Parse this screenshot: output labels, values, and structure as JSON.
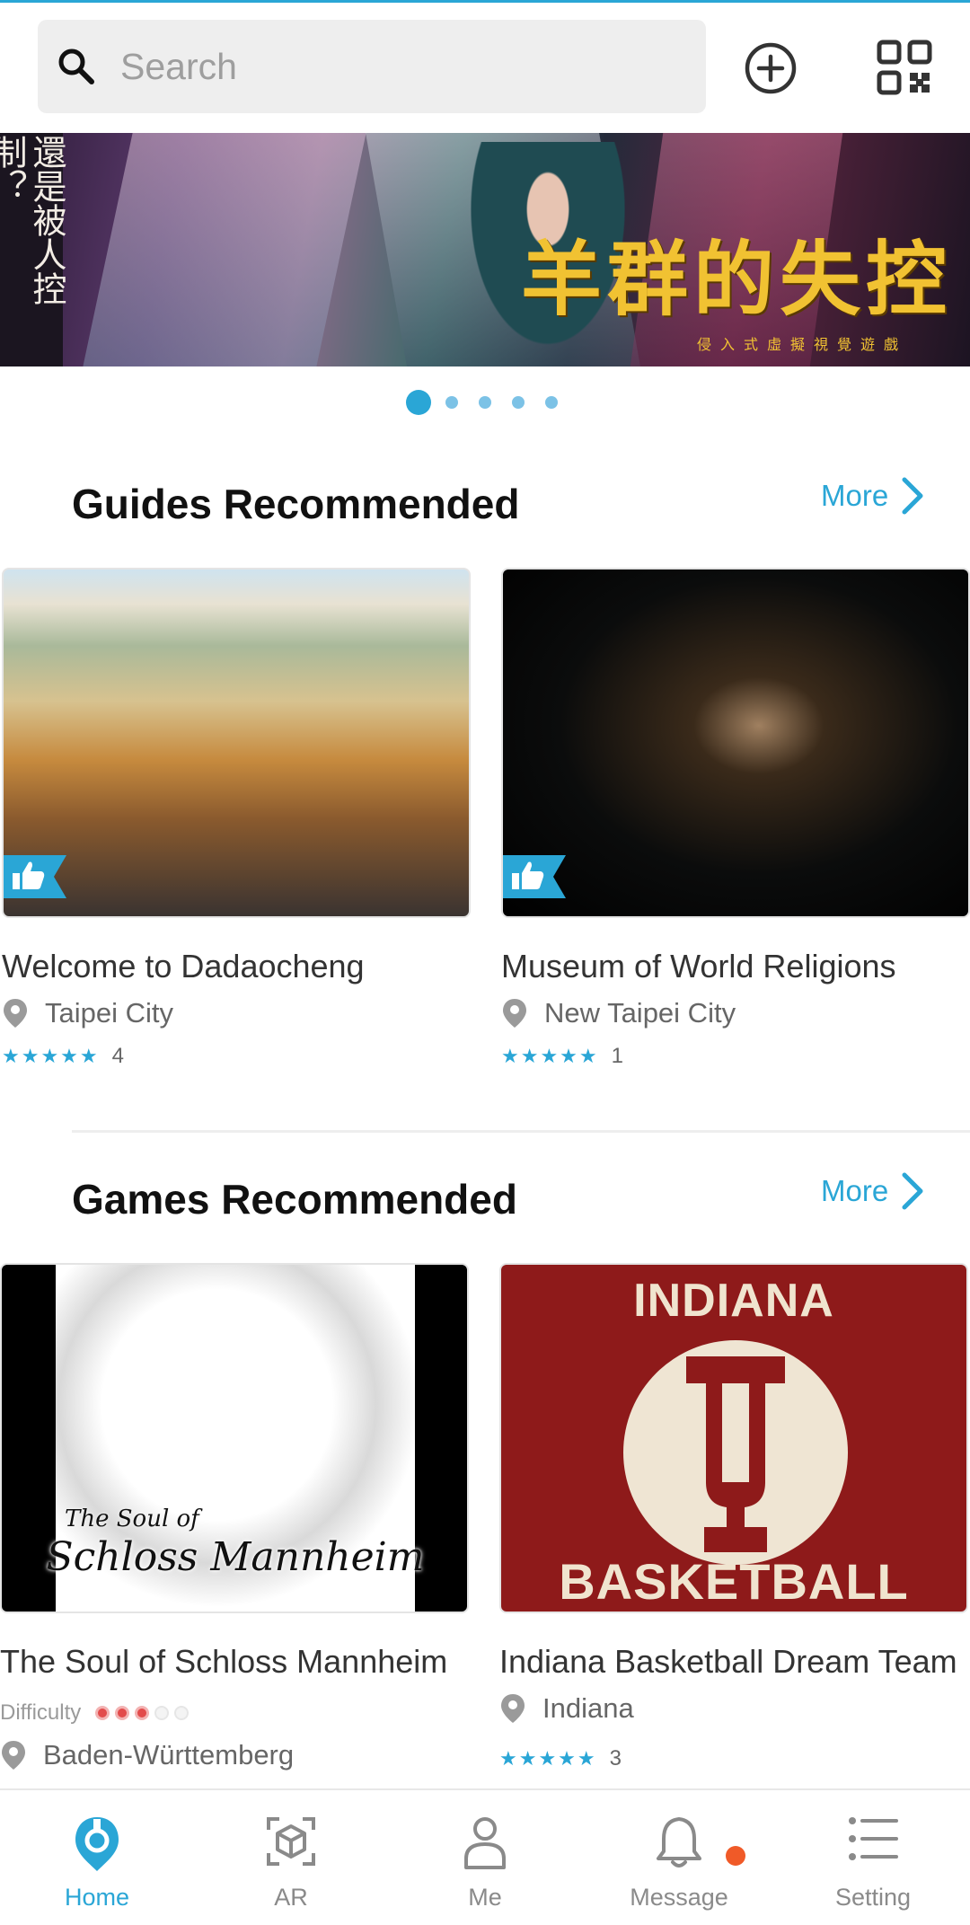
{
  "search": {
    "placeholder": "Search"
  },
  "header": {
    "add_icon": "plus-circle-icon",
    "qr_icon": "qr-code-icon"
  },
  "banner": {
    "vertical_text": "還是被人控制？",
    "title": "羊群的失控",
    "subtitle": "侵入式虛擬視覺遊戲",
    "pagination": {
      "total": 5,
      "active": 1
    }
  },
  "guides": {
    "title": "Guides Recommended",
    "more_label": "More",
    "items": [
      {
        "name": "Welcome to Dadaocheng",
        "location": "Taipei City",
        "stars": "★★★★★",
        "rating_count": "4"
      },
      {
        "name": "Museum of World Religions",
        "location": "New Taipei City",
        "stars": "★★★★★",
        "rating_count": "1"
      }
    ]
  },
  "games": {
    "title": "Games Recommended",
    "more_label": "More",
    "items": [
      {
        "name": "The Soul of Schloss Mannheim",
        "difficulty_label": "Difficulty",
        "difficulty": 3,
        "difficulty_max": 5,
        "location": "Baden-Württemberg",
        "image_text_small": "The Soul of",
        "image_text": "Schloss Mannheim"
      },
      {
        "name": "Indiana Basketball Dream Team",
        "location": "Indiana",
        "stars": "★★★★★",
        "rating_count": "3",
        "image_text_top": "INDIANA",
        "image_text_bottom": "BASKETBALL"
      }
    ]
  },
  "nav": {
    "items": [
      {
        "label": "Home",
        "icon": "home-pin-icon",
        "active": true
      },
      {
        "label": "AR",
        "icon": "ar-cube-icon",
        "active": false
      },
      {
        "label": "Me",
        "icon": "person-icon",
        "active": false
      },
      {
        "label": "Message",
        "icon": "bell-icon",
        "active": false,
        "badge": true
      },
      {
        "label": "Setting",
        "icon": "list-icon",
        "active": false
      }
    ]
  },
  "colors": {
    "accent": "#2aa6d6",
    "badge": "#f05a28",
    "difficulty_on": "#e24b4b"
  }
}
